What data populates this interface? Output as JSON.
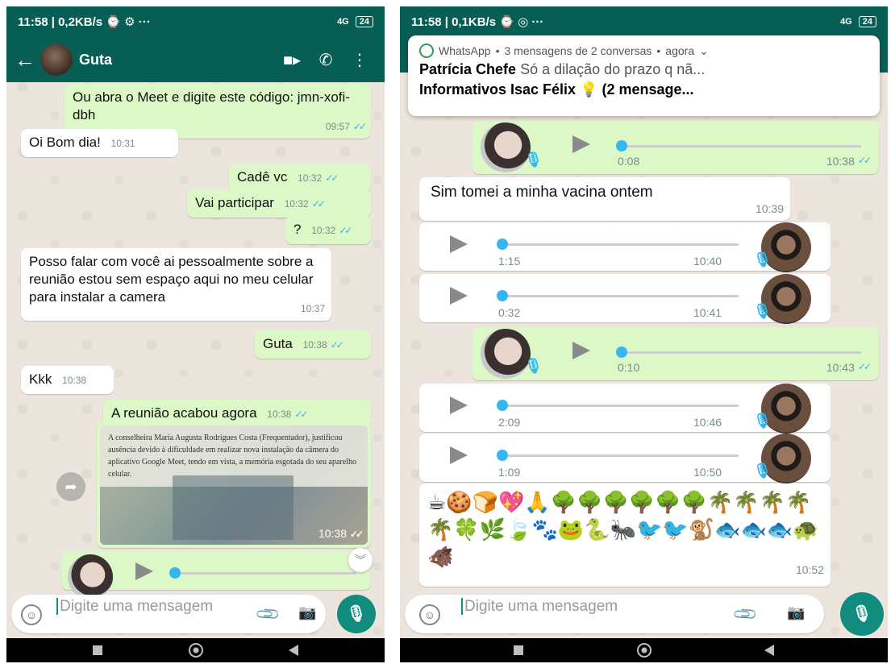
{
  "left": {
    "status": {
      "time": "11:58 | 0,2KB/s",
      "icons": "⌚ ⚙ ···",
      "signal": "4G",
      "battery": "24"
    },
    "header": {
      "back_icon": "back-arrow-icon",
      "contact": "Guta",
      "video_icon": "video-call-icon",
      "call_icon": "phone-call-icon",
      "menu_icon": "more-vertical-icon"
    },
    "messages": [
      {
        "text": "Ou abra o Meet e digite este código: jmn-xofi-dbh",
        "time": "09:57",
        "dir": "out"
      },
      {
        "text": "Oi Bom dia!",
        "time": "10:31",
        "dir": "in"
      },
      {
        "text": "Cadê vc",
        "time": "10:32",
        "dir": "out"
      },
      {
        "text": "Vai participar",
        "time": "10:32",
        "dir": "out"
      },
      {
        "text": "?",
        "time": "10:32",
        "dir": "out"
      },
      {
        "text": "Posso falar com você ai pessoalmente sobre a reunião estou sem espaço aqui no meu celular para instalar a camera",
        "time": "10:37",
        "dir": "in"
      },
      {
        "text": "Guta",
        "time": "10:38",
        "dir": "out"
      },
      {
        "text": "Kkk",
        "time": "10:38",
        "dir": "in"
      },
      {
        "text": "A reunião acabou agora",
        "time": "10:38",
        "dir": "out"
      }
    ],
    "image_msg": {
      "text": "A conselheira Maria Augusta Rodrigues Costa (Frequentador), justificou ausência devido à dificuldade em realizar nova instalação da câmera do aplicativo Google Meet, tendo em vista, a memória esgotada do seu aparelho celular.",
      "time": "10:38"
    },
    "composer": {
      "placeholder": "Digite uma mensagem"
    }
  },
  "right": {
    "status": {
      "time": "11:58 | 0,1KB/s",
      "icons": "⌚ ◎ ···",
      "signal": "4G",
      "battery": "24"
    },
    "notification": {
      "app": "WhatsApp",
      "summary": "3 mensagens de 2 conversas",
      "when": "agora",
      "sender1": "Patrícia Chefe",
      "text1": "Só a dilação do prazo q nã...",
      "sender2": "Informativos Isac Félix",
      "text2": "💡 (2 mensage..."
    },
    "audios": [
      {
        "dir": "out",
        "duration": "0:08",
        "time": "10:38"
      },
      {
        "dir": "in",
        "duration": "1:15",
        "time": "10:40"
      },
      {
        "dir": "in",
        "duration": "0:32",
        "time": "10:41"
      },
      {
        "dir": "out",
        "duration": "0:10",
        "time": "10:43"
      },
      {
        "dir": "in",
        "duration": "2:09",
        "time": "10:46"
      },
      {
        "dir": "in",
        "duration": "1:09",
        "time": "10:50"
      }
    ],
    "text_msg": {
      "text": "Sim tomei a minha vacina ontem",
      "time": "10:39"
    },
    "emoji_msg": {
      "text": "☕🍪🍞💖🙏🌳🌳🌳🌳🌳🌳🌴🌴🌴🌴🌴🍀🌿🍃🐾🐸🐍🐜🐦🐦🐒🐟🐟🐟🐢🐗",
      "time": "10:52"
    },
    "composer": {
      "placeholder": "Digite uma mensagem"
    }
  },
  "colors": {
    "header": "#075e54",
    "outgoing": "#dcf8c6",
    "incoming": "#ffffff",
    "accent": "#128c7e",
    "ticks": "#34b7f1"
  }
}
